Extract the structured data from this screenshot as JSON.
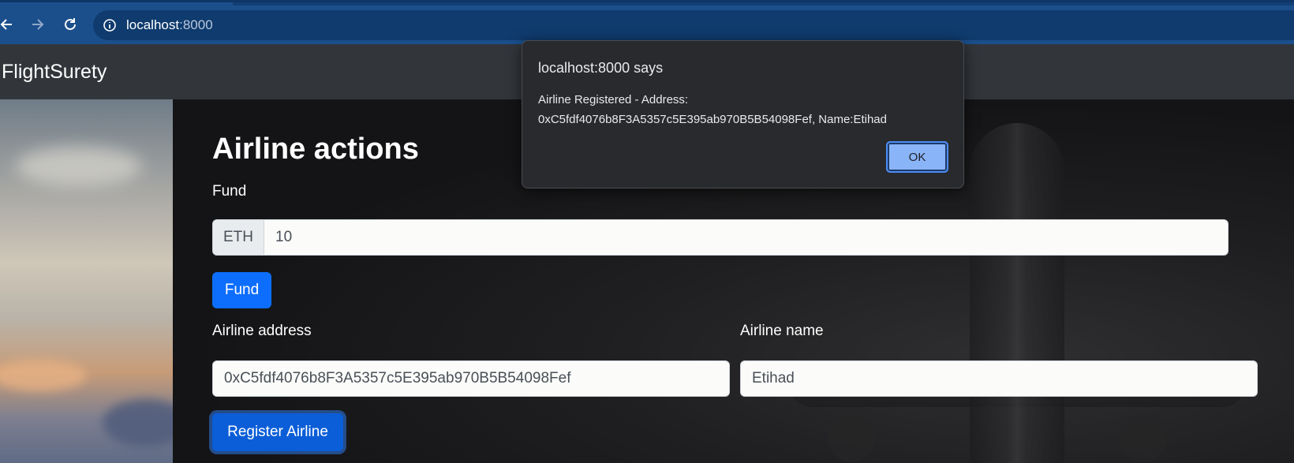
{
  "browser": {
    "url_host": "localhost",
    "url_port": ":8000"
  },
  "navbar": {
    "brand": "FlightSurety"
  },
  "main": {
    "title": "Airline actions",
    "fund_label": "Fund",
    "fund_prefix": "ETH",
    "fund_value": "10",
    "fund_button": "Fund",
    "address_label": "Airline address",
    "address_value": "0xC5fdf4076b8F3A5357c5E395ab970B5B54098Fef",
    "name_label": "Airline name",
    "name_value": "Etihad",
    "register_button": "Register Airline"
  },
  "dialog": {
    "title": "localhost:8000 says",
    "message": "Airline Registered - Address: 0xC5fdf4076b8F3A5357c5E395ab970B5B54098Fef, Name:Etihad",
    "ok_label": "OK"
  },
  "colors": {
    "browser_bar": "#1b4f8c",
    "navbar": "#32363b",
    "primary_button": "#0d6efd",
    "dialog_bg": "#292a2d",
    "dialog_ok": "#8ab4f8"
  },
  "icons": [
    "back-arrow-icon",
    "forward-arrow-icon",
    "reload-icon",
    "site-info-icon"
  ]
}
